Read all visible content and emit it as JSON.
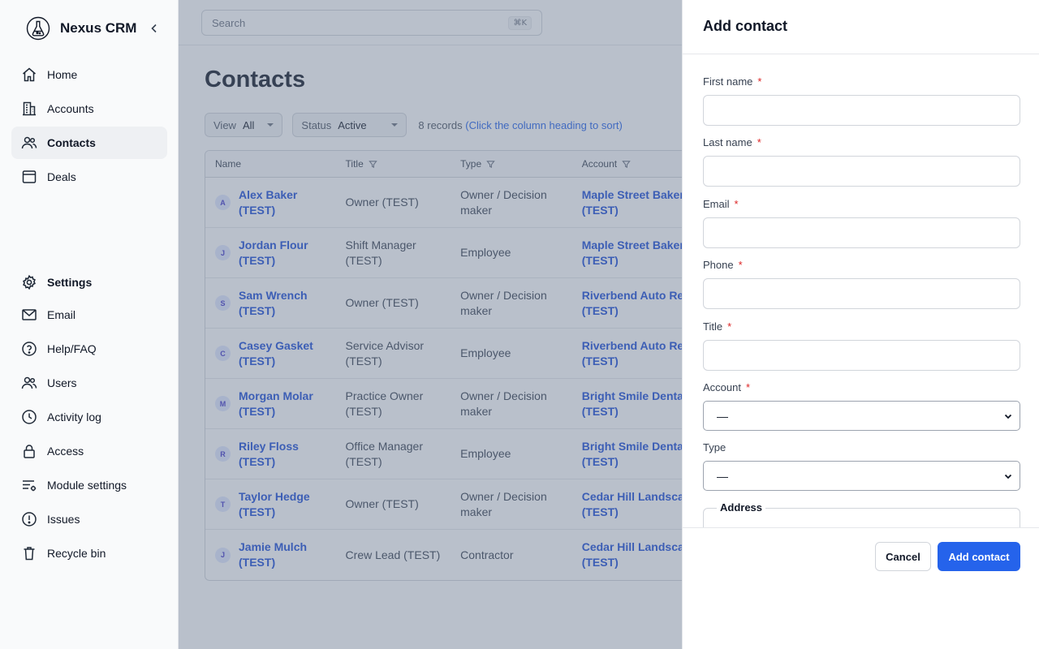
{
  "app": {
    "name": "Nexus CRM"
  },
  "sidebar": {
    "items": [
      {
        "label": "Home",
        "icon": "home-icon"
      },
      {
        "label": "Accounts",
        "icon": "building-icon"
      },
      {
        "label": "Contacts",
        "icon": "users-icon",
        "active": true
      },
      {
        "label": "Deals",
        "icon": "browser-window-icon"
      }
    ],
    "settings_label": "Settings",
    "settings_items": [
      {
        "label": "Email",
        "icon": "mail-icon"
      },
      {
        "label": "Help/FAQ",
        "icon": "help-circle-icon"
      },
      {
        "label": "Users",
        "icon": "users-icon"
      },
      {
        "label": "Activity log",
        "icon": "clock-icon"
      },
      {
        "label": "Access",
        "icon": "lock-icon"
      },
      {
        "label": "Module settings",
        "icon": "list-settings-icon"
      },
      {
        "label": "Issues",
        "icon": "alert-circle-icon"
      },
      {
        "label": "Recycle bin",
        "icon": "trash-icon"
      }
    ]
  },
  "search": {
    "placeholder": "Search",
    "shortcut": "⌘K"
  },
  "page": {
    "title": "Contacts"
  },
  "filters": {
    "view": {
      "label": "View",
      "value": "All"
    },
    "status": {
      "label": "Status",
      "value": "Active"
    },
    "record_count": "8 records",
    "sort_hint": "(Click the column heading to sort)"
  },
  "table": {
    "columns": [
      "Name",
      "Title",
      "Type",
      "Account"
    ],
    "rows": [
      {
        "initial": "A",
        "name": [
          "Alex Baker",
          "(TEST)"
        ],
        "title": [
          "Owner (TEST)"
        ],
        "type": [
          "Owner / Decision",
          "maker"
        ],
        "account": [
          "Maple Street Bakery",
          "(TEST)"
        ]
      },
      {
        "initial": "J",
        "name": [
          "Jordan Flour",
          "(TEST)"
        ],
        "title": [
          "Shift Manager",
          "(TEST)"
        ],
        "type": [
          "Employee"
        ],
        "account": [
          "Maple Street Bakery",
          "(TEST)"
        ]
      },
      {
        "initial": "S",
        "name": [
          "Sam Wrench",
          "(TEST)"
        ],
        "title": [
          "Owner (TEST)"
        ],
        "type": [
          "Owner / Decision",
          "maker"
        ],
        "account": [
          "Riverbend Auto Repair",
          "(TEST)"
        ]
      },
      {
        "initial": "C",
        "name": [
          "Casey Gasket",
          "(TEST)"
        ],
        "title": [
          "Service Advisor",
          "(TEST)"
        ],
        "type": [
          "Employee"
        ],
        "account": [
          "Riverbend Auto Repair",
          "(TEST)"
        ]
      },
      {
        "initial": "M",
        "name": [
          "Morgan Molar",
          "(TEST)"
        ],
        "title": [
          "Practice Owner",
          "(TEST)"
        ],
        "type": [
          "Owner / Decision",
          "maker"
        ],
        "account": [
          "Bright Smile Dental",
          "(TEST)"
        ]
      },
      {
        "initial": "R",
        "name": [
          "Riley Floss",
          "(TEST)"
        ],
        "title": [
          "Office Manager",
          "(TEST)"
        ],
        "type": [
          "Employee"
        ],
        "account": [
          "Bright Smile Dental",
          "(TEST)"
        ]
      },
      {
        "initial": "T",
        "name": [
          "Taylor Hedge",
          "(TEST)"
        ],
        "title": [
          "Owner (TEST)"
        ],
        "type": [
          "Owner / Decision",
          "maker"
        ],
        "account": [
          "Cedar Hill Landscaping",
          "(TEST)"
        ]
      },
      {
        "initial": "J",
        "name": [
          "Jamie Mulch",
          "(TEST)"
        ],
        "title": [
          "Crew Lead (TEST)"
        ],
        "type": [
          "Contractor"
        ],
        "account": [
          "Cedar Hill Landscaping",
          "(TEST)"
        ]
      }
    ]
  },
  "drawer": {
    "title": "Add contact",
    "fields": {
      "first_name": "First name",
      "last_name": "Last name",
      "email": "Email",
      "phone": "Phone",
      "title": "Title",
      "account": "Account",
      "type": "Type"
    },
    "required_mark": "*",
    "account_value": "—",
    "type_value": "—",
    "address_legend": "Address",
    "cancel_label": "Cancel",
    "submit_label": "Add contact"
  },
  "colors": {
    "accent": "#2563eb",
    "link": "#1d4ed8",
    "required": "#dc2626"
  }
}
